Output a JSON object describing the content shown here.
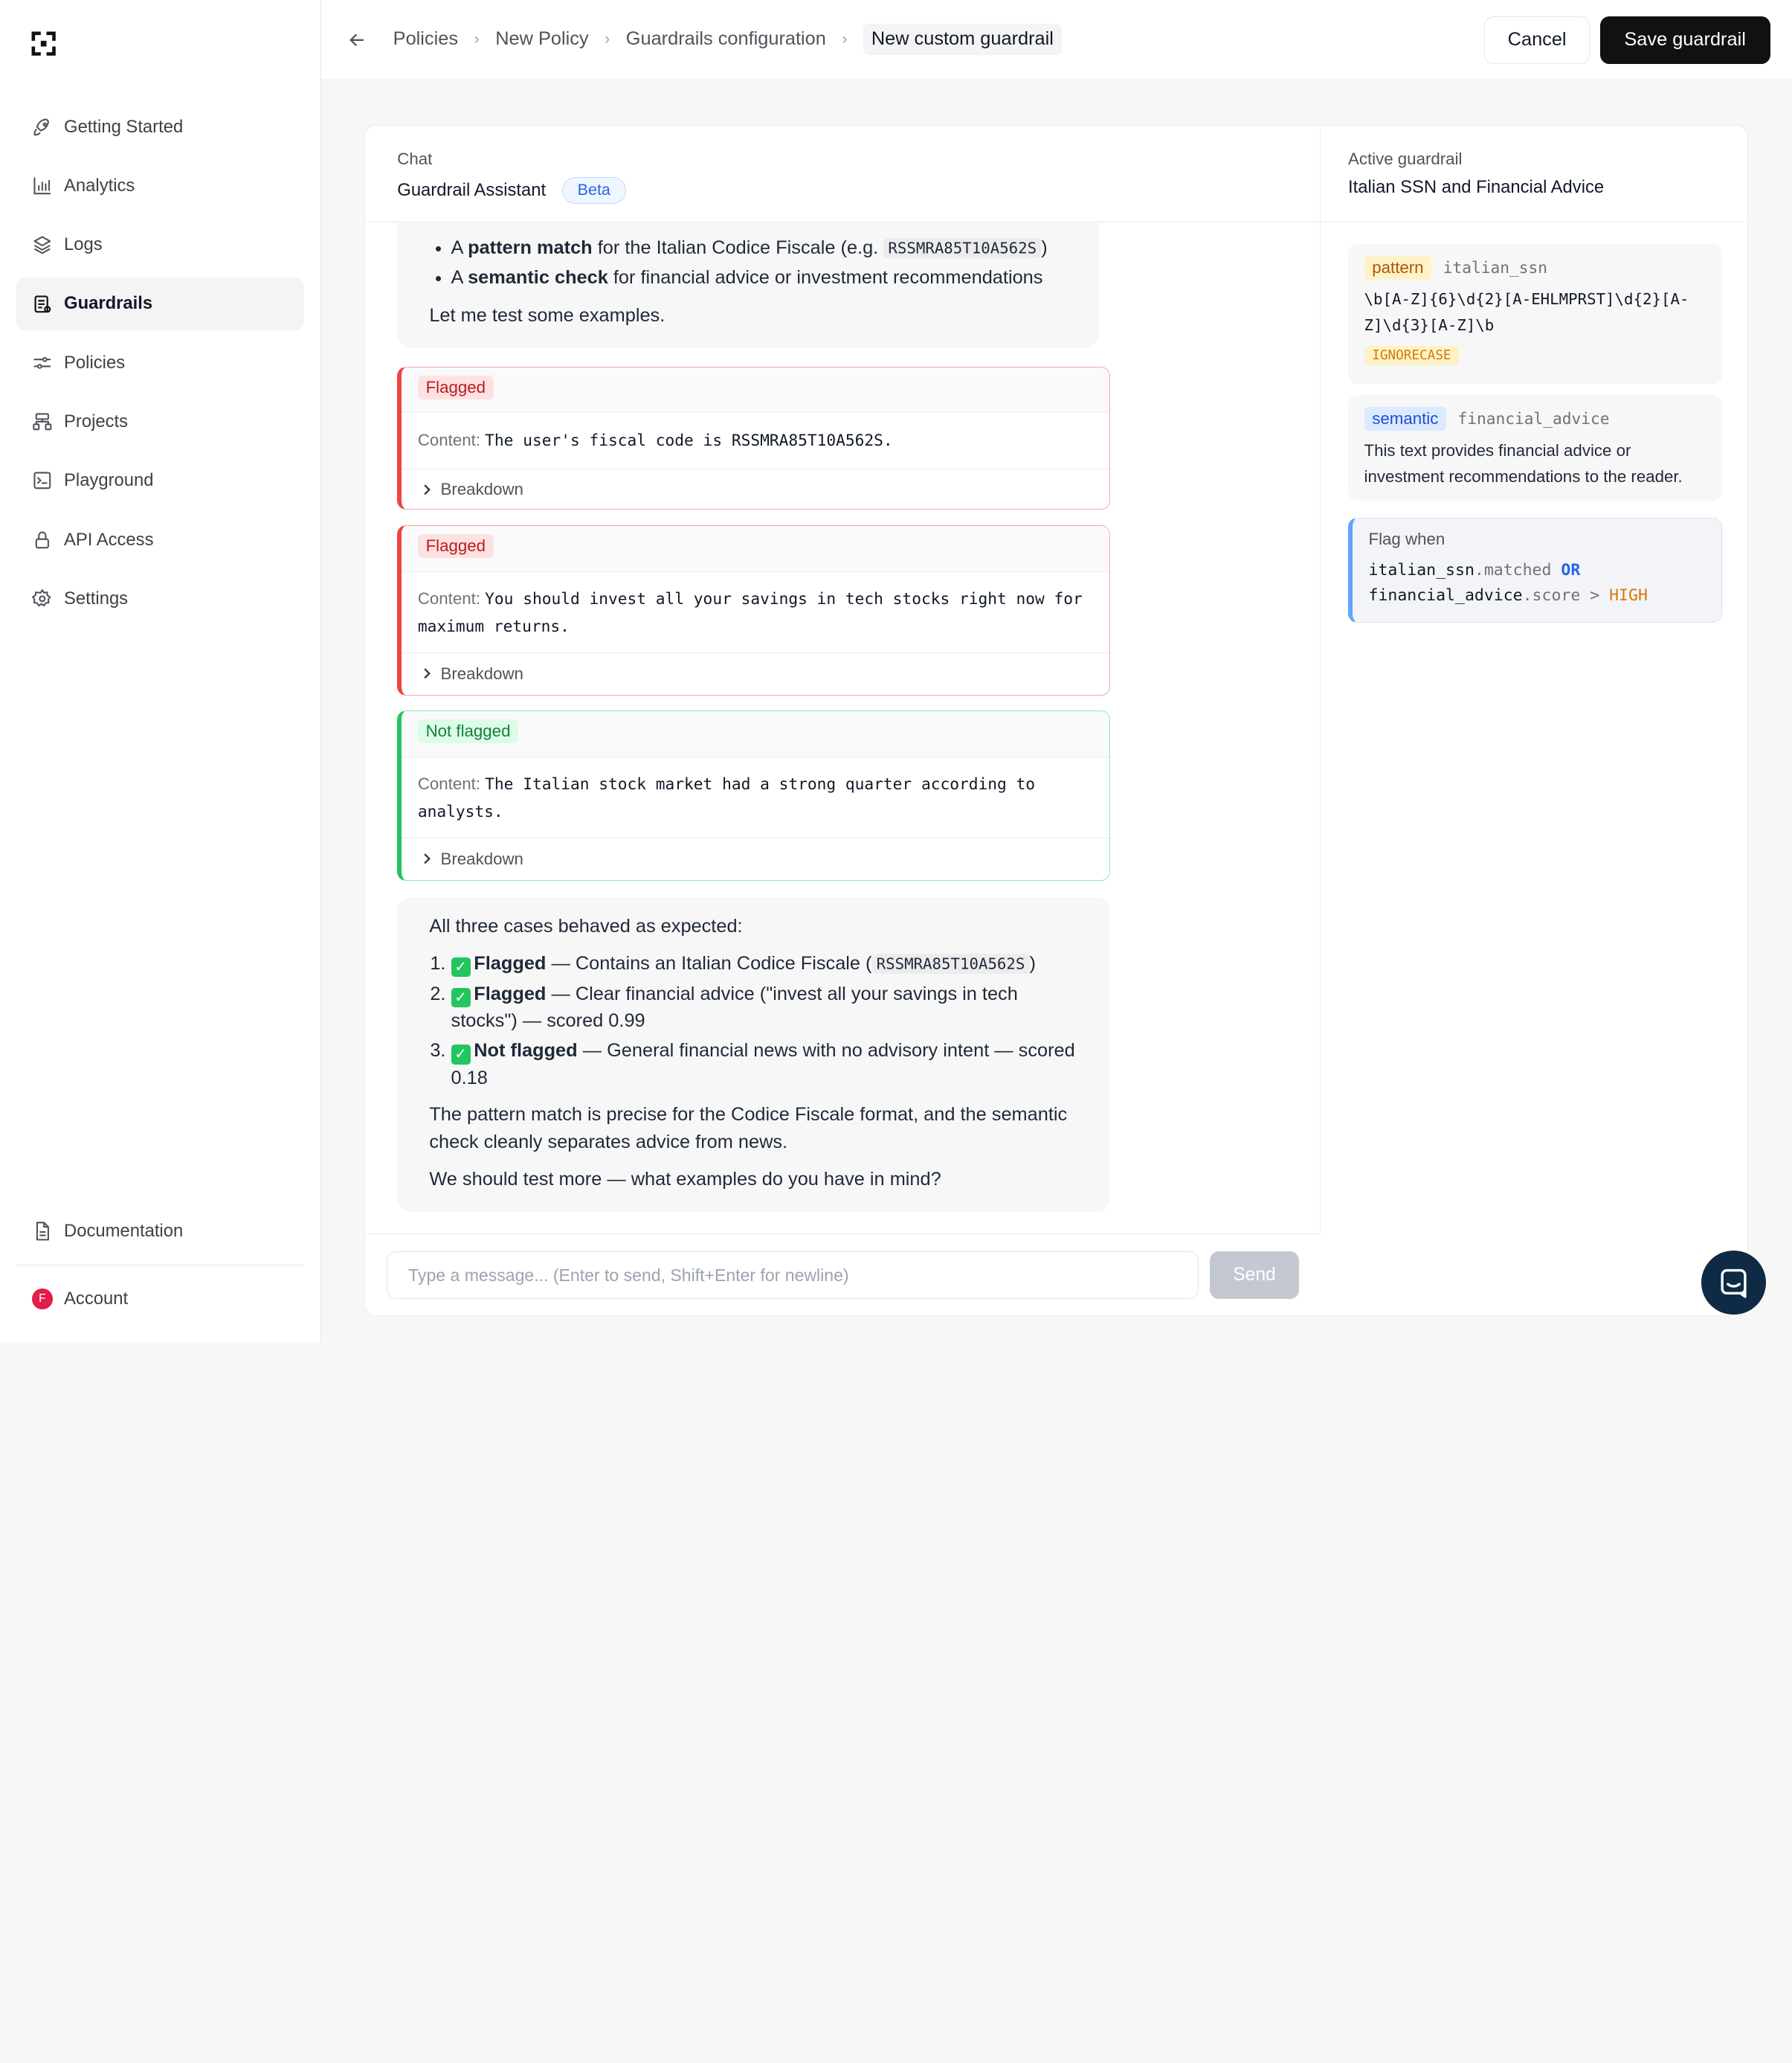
{
  "sidebar": {
    "items": [
      {
        "label": "Getting Started",
        "icon": "rocket-icon"
      },
      {
        "label": "Analytics",
        "icon": "bar-chart-icon"
      },
      {
        "label": "Logs",
        "icon": "layers-icon"
      },
      {
        "label": "Guardrails",
        "icon": "clipboard-icon",
        "active": true
      },
      {
        "label": "Policies",
        "icon": "sliders-icon"
      },
      {
        "label": "Projects",
        "icon": "sitemap-icon"
      },
      {
        "label": "Playground",
        "icon": "terminal-icon"
      },
      {
        "label": "API Access",
        "icon": "lock-icon"
      },
      {
        "label": "Settings",
        "icon": "gear-icon"
      }
    ],
    "documentation": "Documentation",
    "account": "Account",
    "account_initial": "F"
  },
  "breadcrumb": [
    "Policies",
    "New Policy",
    "Guardrails configuration",
    "New custom guardrail"
  ],
  "actions": {
    "cancel": "Cancel",
    "save": "Save guardrail"
  },
  "chat": {
    "kicker": "Chat",
    "title": "Guardrail Assistant",
    "badge": "Beta",
    "intro": {
      "b1_pre": "A ",
      "b1_bold": "pattern match",
      "b1_post": " for the Italian Codice Fiscale (e.g. ",
      "b1_code": "RSSMRA85T10A562S",
      "b1_end": ")",
      "b2_pre": "A ",
      "b2_bold": "semantic check",
      "b2_post": " for financial advice or investment recommendations",
      "closing": "Let me test some examples."
    },
    "results": [
      {
        "tag": "Flagged",
        "content_label": "Content:",
        "content": "The user's fiscal code is RSSMRA85T10A562S.",
        "breakdown": "Breakdown"
      },
      {
        "tag": "Flagged",
        "content_label": "Content:",
        "content": "You should invest all your savings in tech stocks right now for maximum returns.",
        "breakdown": "Breakdown"
      },
      {
        "tag": "Not flagged",
        "content_label": "Content:",
        "content": "The Italian stock market had a strong quarter according to analysts.",
        "breakdown": "Breakdown"
      }
    ],
    "summary": {
      "lead": "All three cases behaved as expected:",
      "items": [
        {
          "bold": "Flagged",
          "text_pre": " — Contains an Italian Codice Fiscale (",
          "code": "RSSMRA85T10A562S",
          "text_post": ")"
        },
        {
          "bold": "Flagged",
          "text": " — Clear financial advice (\"invest all your savings in tech stocks\") — scored 0.99"
        },
        {
          "bold": "Not flagged",
          "text": " — General financial news with no advisory intent — scored 0.18"
        }
      ],
      "p1": "The pattern match is precise for the Codice Fiscale format, and the semantic check cleanly separates advice from news.",
      "p2": "We should test more — what examples do you have in mind?"
    },
    "composer": {
      "placeholder": "Type a message... (Enter to send, Shift+Enter for newline)",
      "send": "Send"
    }
  },
  "guardrail": {
    "kicker": "Active guardrail",
    "title": "Italian SSN and Financial Advice",
    "pattern": {
      "kind": "pattern",
      "name": "italian_ssn",
      "regex": "\\b[A-Z]{6}\\d{2}[A-EHLMPRST]\\d{2}[A-Z]\\d{3}[A-Z]\\b",
      "flag": "IGNORECASE"
    },
    "semantic": {
      "kind": "semantic",
      "name": "financial_advice",
      "description": "This text provides financial advice or investment recommendations to the reader."
    },
    "flag_when": {
      "label": "Flag when",
      "line1_a": "italian_ssn",
      "line1_b": ".matched",
      "op": "OR",
      "line2_a": "financial_advice",
      "line2_b": ".score > ",
      "level": "HIGH"
    }
  },
  "colors": {
    "accent": "#2563eb",
    "flagged": "#ef4444",
    "ok": "#22c55e",
    "primary_button": "#111111"
  }
}
